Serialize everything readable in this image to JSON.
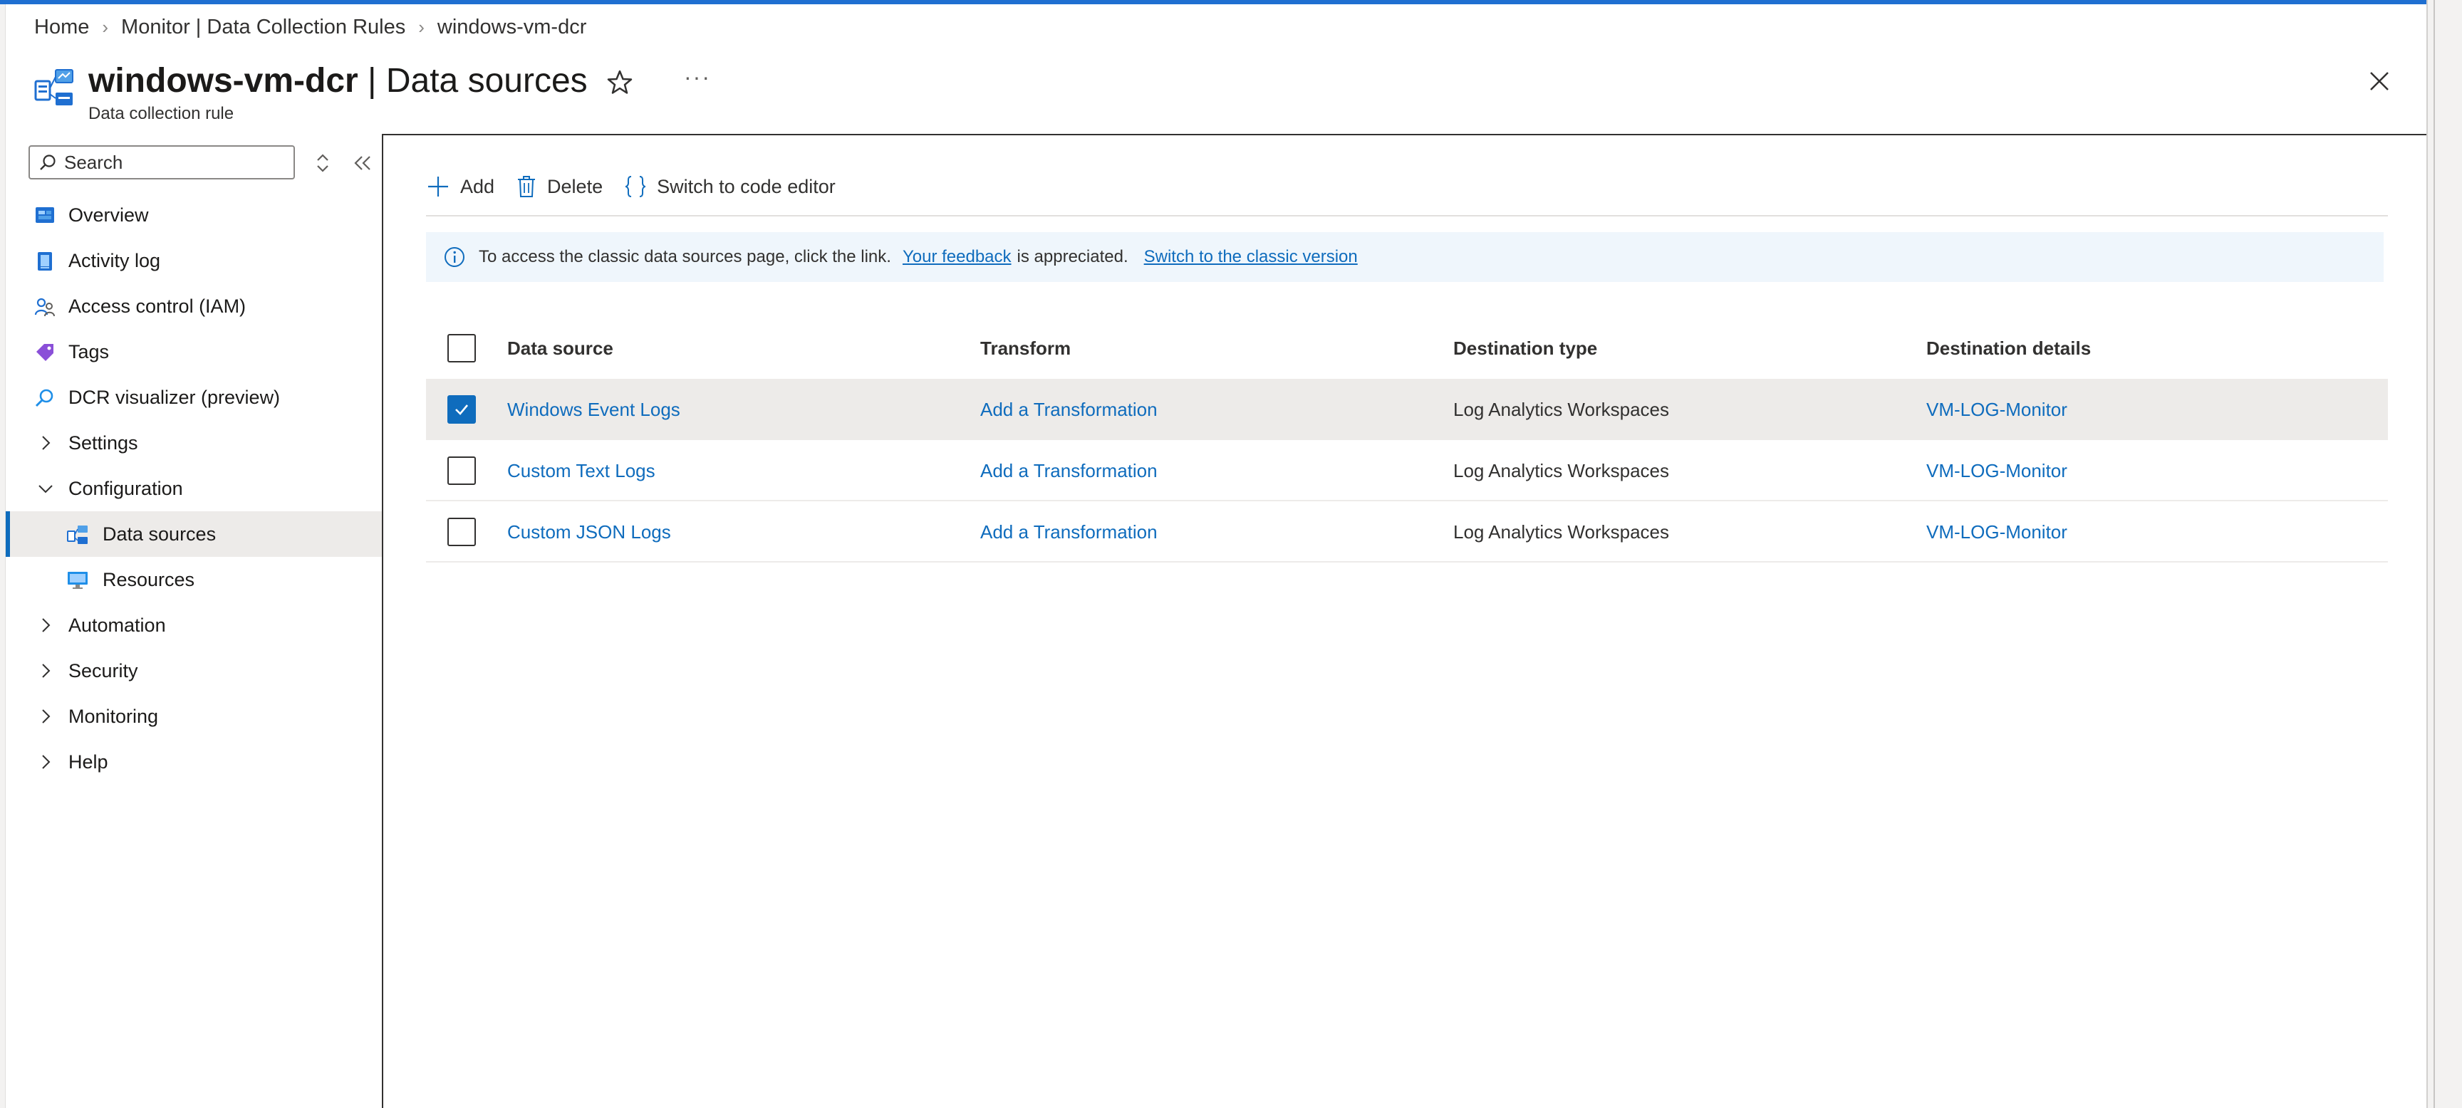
{
  "breadcrumb": {
    "items": [
      "Home",
      "Monitor | Data Collection Rules",
      "windows-vm-dcr"
    ]
  },
  "header": {
    "title_bold": "windows-vm-dcr",
    "title_rest": " | Data sources",
    "subtitle": "Data collection rule"
  },
  "sidebar": {
    "search_placeholder": "Search",
    "items": [
      {
        "label": "Overview"
      },
      {
        "label": "Activity log"
      },
      {
        "label": "Access control (IAM)"
      },
      {
        "label": "Tags"
      },
      {
        "label": "DCR visualizer (preview)"
      },
      {
        "label": "Settings"
      },
      {
        "label": "Configuration"
      },
      {
        "label": "Data sources"
      },
      {
        "label": "Resources"
      },
      {
        "label": "Automation"
      },
      {
        "label": "Security"
      },
      {
        "label": "Monitoring"
      },
      {
        "label": "Help"
      }
    ]
  },
  "toolbar": {
    "add_label": "Add",
    "delete_label": "Delete",
    "code_editor_label": "Switch to code editor"
  },
  "info": {
    "text_before": "To access the classic data sources page, click the link.",
    "feedback_link": "Your feedback",
    "text_after": "is appreciated.",
    "classic_link": "Switch to the classic version"
  },
  "table": {
    "headers": [
      "Data source",
      "Transform",
      "Destination type",
      "Destination details"
    ],
    "rows": [
      {
        "source": "Windows Event Logs",
        "transform": "Add a Transformation",
        "dest_type": "Log Analytics Workspaces",
        "dest_details": "VM-LOG-Monitor",
        "checked": true
      },
      {
        "source": "Custom Text Logs",
        "transform": "Add a Transformation",
        "dest_type": "Log Analytics Workspaces",
        "dest_details": "VM-LOG-Monitor",
        "checked": false
      },
      {
        "source": "Custom JSON Logs",
        "transform": "Add a Transformation",
        "dest_type": "Log Analytics Workspaces",
        "dest_details": "VM-LOG-Monitor",
        "checked": false
      }
    ]
  },
  "colors": {
    "accent": "#0f6cbd",
    "top_bar": "#1f6fd1",
    "selected_bg": "#edebe9",
    "info_bg": "#eff6fc"
  }
}
